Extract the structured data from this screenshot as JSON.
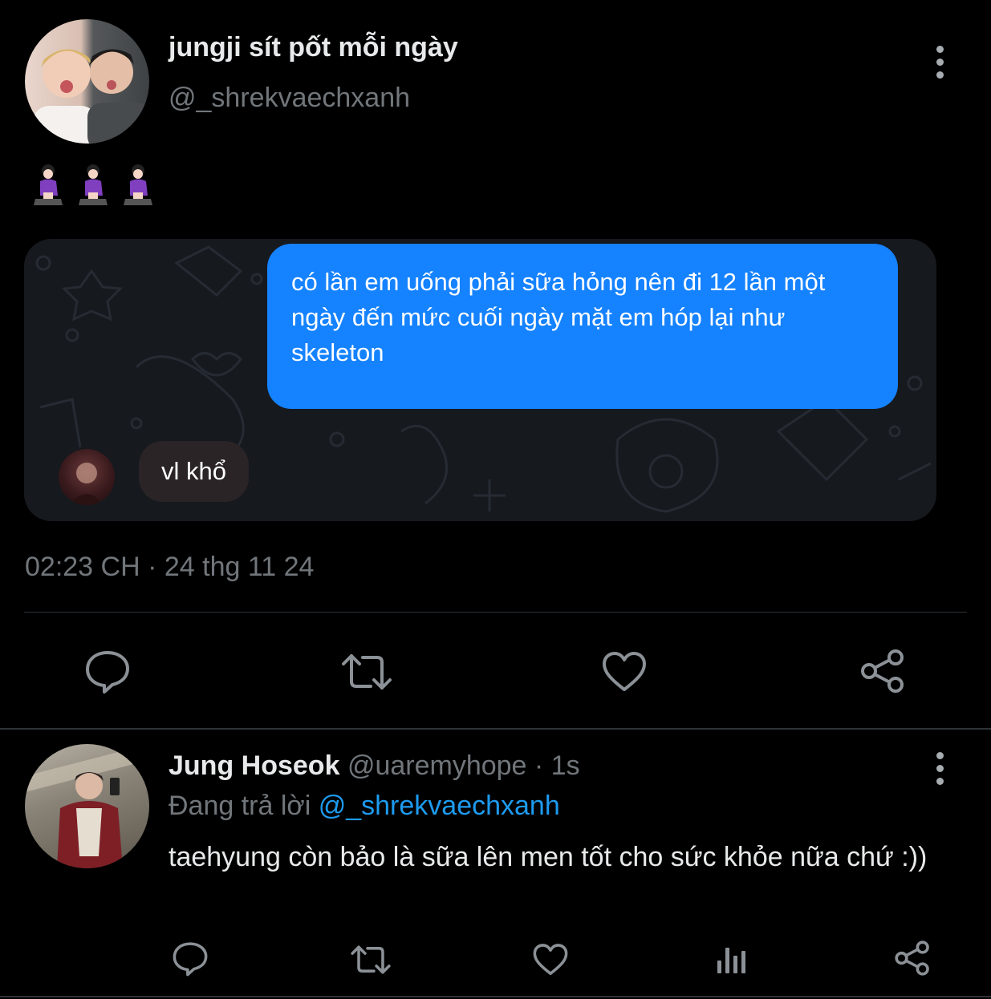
{
  "post": {
    "display_name": "jungji sít pốt mỗi ngày",
    "handle": "@_shrekvaechxanh",
    "emoji_text": "🧎‍♀️🧎‍♀️🧎‍♀️",
    "chat": {
      "outgoing": "có lần em uống phải sữa hỏng nên đi 12 lần một ngày đến mức cuối ngày mặt em hóp lại như skeleton",
      "incoming": "vl khổ"
    },
    "timestamp": "02:23 CH · 24 thg 11 24",
    "actions": [
      "reply-icon",
      "retweet-icon",
      "like-icon",
      "share-icon"
    ]
  },
  "reply": {
    "display_name": "Jung Hoseok",
    "handle_time": "@uaremyhope · 1s",
    "replying_prefix": "Đang trả lời",
    "replying_to": "@_shrekvaechxanh",
    "text": "taehyung còn bảo là sữa lên men tốt cho sức khỏe nữa chứ :))",
    "actions": [
      "reply-icon",
      "retweet-icon",
      "like-icon",
      "views-icon",
      "share-icon"
    ]
  },
  "colors": {
    "background": "#000000",
    "outgoing_bubble": "#1582ff",
    "link": "#1d9bf0",
    "muted": "#71767b"
  }
}
